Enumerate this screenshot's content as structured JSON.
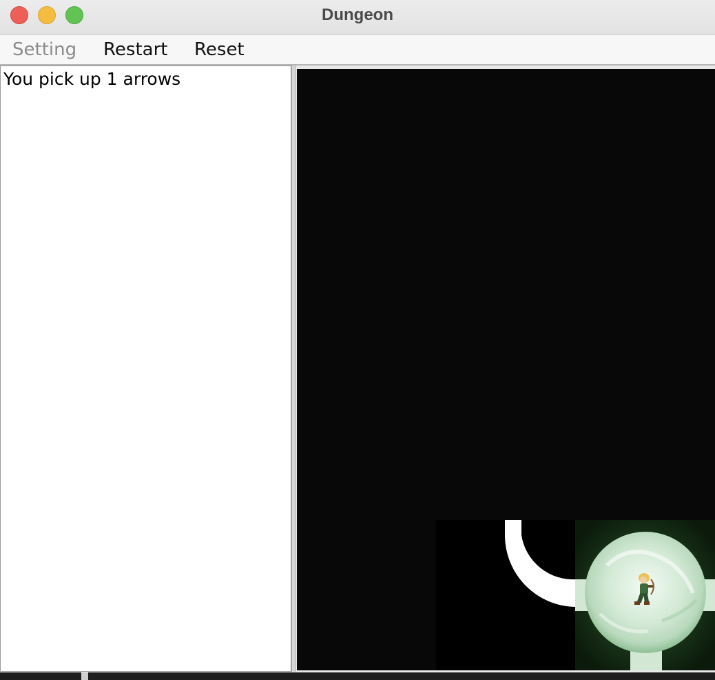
{
  "window": {
    "title": "Dungeon"
  },
  "menu": {
    "setting": "Setting",
    "restart": "Restart",
    "reset": "Reset"
  },
  "log": {
    "message": "You pick up 1 arrows"
  },
  "game": {
    "tiles": [
      {
        "type": "dark-cave",
        "icon": "cave-tile"
      },
      {
        "type": "tunnel-curve",
        "icon": "tunnel-tile"
      },
      {
        "type": "cave-with-player",
        "icon": "player-sprite"
      }
    ],
    "colors": {
      "background": "#080808",
      "path": "#ffffff",
      "orb": "#d9eddc",
      "orb_glow": "#1f3a1f"
    }
  },
  "colors": {
    "close": "#ee5f58",
    "minimize": "#f5bd3f",
    "maximize": "#61c454"
  }
}
